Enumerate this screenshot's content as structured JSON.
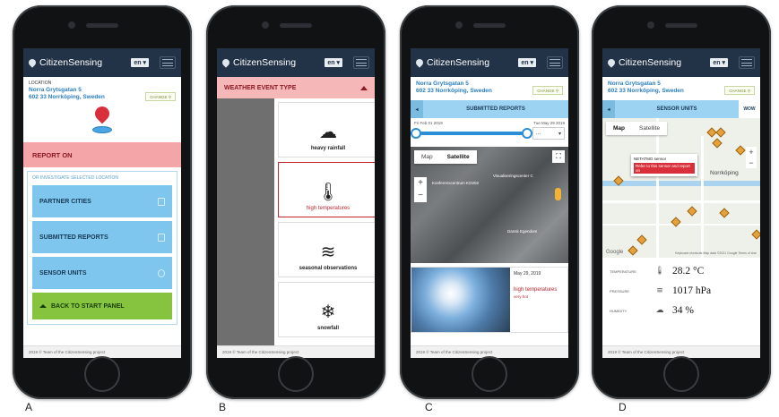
{
  "app": {
    "name": "CitizenSensing",
    "lang": "en ▾",
    "footer": "2019 © Team of the CitizenSensing project"
  },
  "screen_a": {
    "location_label": "LOCATION",
    "address_line1": "Norra Grytsgatan 5",
    "address_line2": "602 33 Norrköping, Sweden",
    "change_label": "CHANGE ⚲",
    "report_on": "REPORT ON",
    "investigate_header": "OR INVESTIGATE SELECTED LOCATION",
    "buttons": [
      "PARTNER CITIES",
      "SUBMITTED REPORTS",
      "SENSOR UNITS"
    ],
    "back_label": "BACK TO START PANEL"
  },
  "screen_b": {
    "header": "WEATHER EVENT TYPE",
    "events": [
      {
        "label": "heavy rainfall",
        "icon": "cloud-rain-icon",
        "glyph": "☁"
      },
      {
        "label": "high temperatures",
        "icon": "thermometer-sun-icon",
        "glyph": "🌡"
      },
      {
        "label": "seasonal observations",
        "icon": "wind-leaf-icon",
        "glyph": "≋"
      },
      {
        "label": "snowfall",
        "icon": "cloud-snow-icon",
        "glyph": "❄"
      }
    ]
  },
  "screen_c": {
    "address_line1": "Norra Grytsgatan 5",
    "address_line2": "602 33 Norrköping, Sweden",
    "change_label": "CHANGE ⚲",
    "header": "SUBMITTED REPORTS",
    "date_from": "Fri Feb 01 2019",
    "date_to": "Tue May 29 2019",
    "dropdown": "...",
    "map_tabs": [
      "Map",
      "Satellite"
    ],
    "map_labels": [
      "Konferenscentrum KO202",
      "Visualiseringscenter C",
      "Dansk Egendom"
    ],
    "report": {
      "date": "May 29, 2019",
      "event": "high temperatures",
      "severity": "very hot"
    }
  },
  "screen_d": {
    "address_line1": "Norra Grytsgatan 5",
    "address_line2": "602 33 Norrköping, Sweden",
    "change_label": "CHANGE ⚲",
    "header": "SENSOR UNITS",
    "header_right": "WOW",
    "map_tabs": [
      "Map",
      "Satellite"
    ],
    "popup_title": "NETATMO sensor",
    "popup_link": "Refer to this sensor and report on",
    "city": "Norrköping",
    "google": "Google",
    "attribution": "Keyboard shortcuts  Map data ©2021 Google  Terms of Use",
    "readings": [
      {
        "key": "TEMPERATURE",
        "icon": "thermometer-icon",
        "glyph": "🌡",
        "value": "28.2 °C"
      },
      {
        "key": "PRESSURE",
        "icon": "pressure-icon",
        "glyph": "≡",
        "value": "1017 hPa"
      },
      {
        "key": "HUMIDITY",
        "icon": "cloud-icon",
        "glyph": "☁",
        "value": "34 %"
      }
    ]
  },
  "figure_labels": [
    "A",
    "B",
    "C",
    "D"
  ]
}
